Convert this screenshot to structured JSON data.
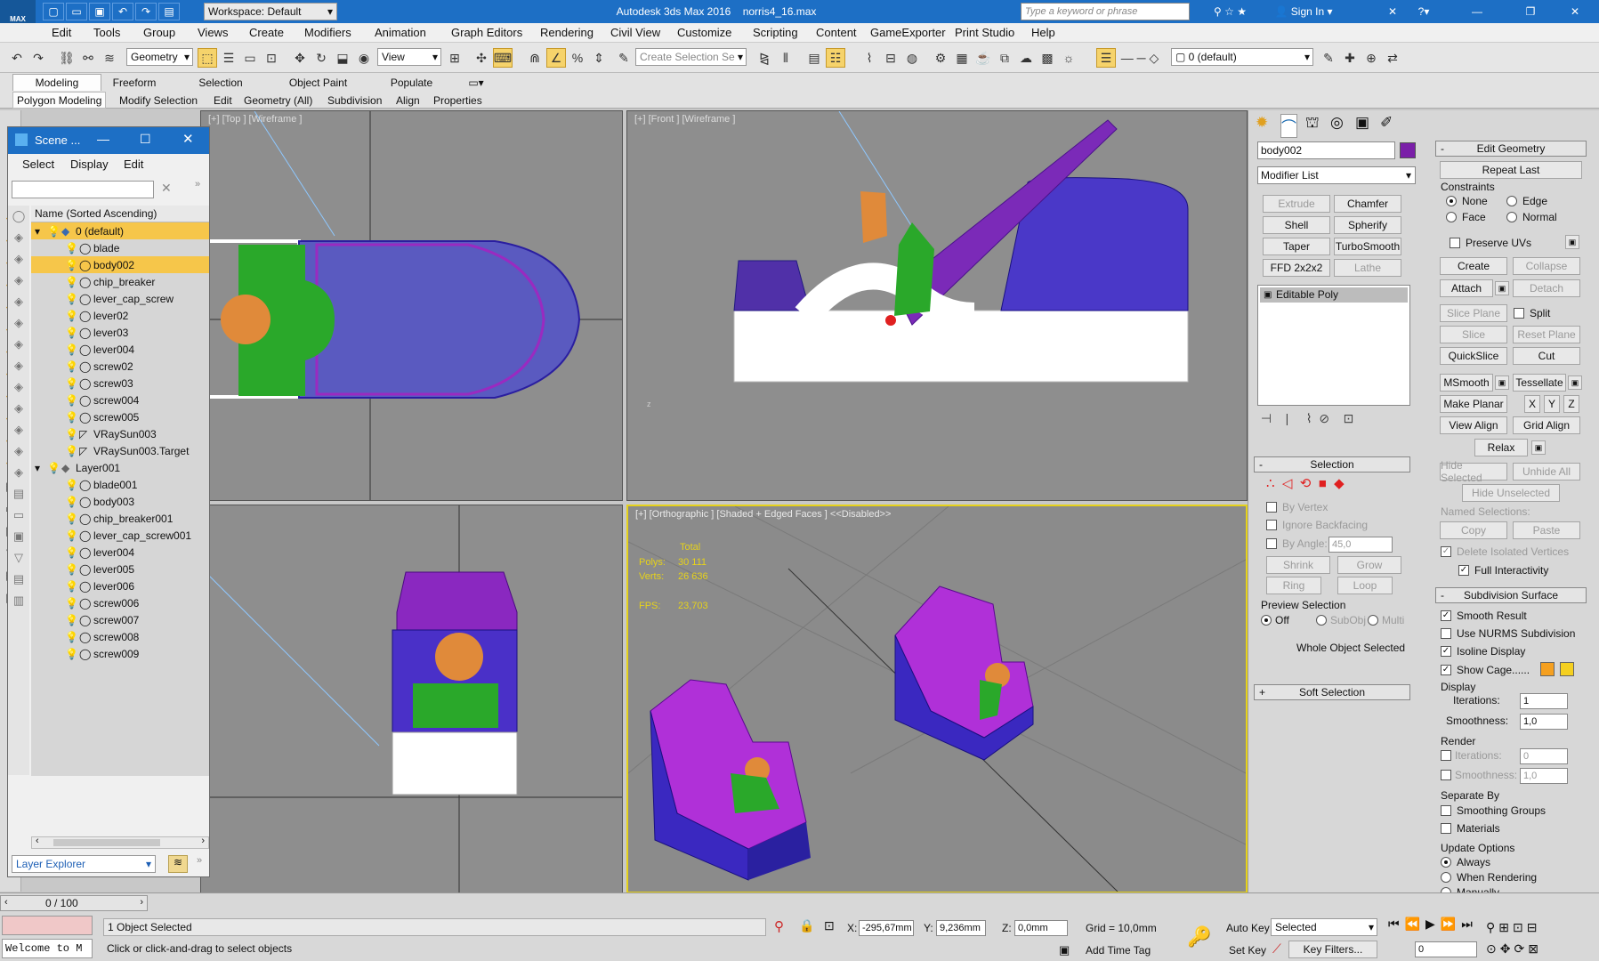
{
  "titlebar": {
    "app_title": "Autodesk 3ds Max 2016",
    "file_name": "norris4_16.max",
    "workspace": "Workspace: Default",
    "search_placeholder": "Type a keyword or phrase",
    "sign_in": "Sign In",
    "logo": "MAX"
  },
  "menu": [
    "Edit",
    "Tools",
    "Group",
    "Views",
    "Create",
    "Modifiers",
    "Animation",
    "Graph Editors",
    "Rendering",
    "Civil View",
    "Customize",
    "Scripting",
    "Content",
    "GameExporter",
    "Print Studio",
    "Help"
  ],
  "toolbar": {
    "selection_filter": "Geometry",
    "ref_coord": "View",
    "named_selection_placeholder": "Create Selection Se",
    "layer": "0 (default)"
  },
  "ribbon": {
    "tabs": [
      "Modeling",
      "Freeform",
      "Selection",
      "Object Paint",
      "Populate"
    ],
    "subtabs": [
      "Polygon Modeling",
      "Modify Selection",
      "Edit",
      "Geometry (All)",
      "Subdivision",
      "Align",
      "Properties"
    ]
  },
  "viewports": {
    "top": "[+] [Top ] [Wireframe ]",
    "front": "[+] [Front ] [Wireframe ]",
    "left": "",
    "persp": "[+] [Orthographic ] [Shaded + Edged Faces ]  <<Disabled>>",
    "stats": {
      "total_label": "Total",
      "polys_label": "Polys:",
      "polys": "30 111",
      "verts_label": "Verts:",
      "verts": "26 636",
      "fps_label": "FPS:",
      "fps": "23,703"
    }
  },
  "scene": {
    "title": "Scene ...",
    "menu": [
      "Select",
      "Display",
      "Edit"
    ],
    "column": "Name (Sorted Ascending)",
    "footer": "Layer Explorer",
    "layer1": "0 (default)",
    "items1": [
      "blade",
      "body002",
      "chip_breaker",
      "lever_cap_screw",
      "lever02",
      "lever03",
      "lever004",
      "screw02",
      "screw03",
      "screw004",
      "screw005",
      "VRaySun003",
      "VRaySun003.Target"
    ],
    "layer2": "Layer001",
    "items2": [
      "blade001",
      "body003",
      "chip_breaker001",
      "lever_cap_screw001",
      "lever004",
      "lever005",
      "lever006",
      "screw006",
      "screw007",
      "screw008",
      "screw009"
    ]
  },
  "cmd": {
    "object_name": "body002",
    "object_color": "#7a1fa8",
    "modifier_list": "Modifier List",
    "mod_buttons": [
      "Extrude",
      "Chamfer",
      "Shell",
      "Spherify",
      "Taper",
      "TurboSmooth",
      "FFD 2x2x2",
      "Lathe"
    ],
    "stack_item": "Editable Poly",
    "selection": {
      "title": "Selection",
      "by_vertex": "By Vertex",
      "ignore_backfacing": "Ignore Backfacing",
      "by_angle": "By Angle:",
      "angle": "45,0",
      "shrink": "Shrink",
      "grow": "Grow",
      "ring": "Ring",
      "loop": "Loop",
      "preview": "Preview Selection",
      "off": "Off",
      "subobj": "SubObj",
      "multi": "Multi",
      "whole": "Whole Object Selected"
    },
    "soft_selection": "Soft Selection",
    "edit_geometry": {
      "title": "Edit Geometry",
      "repeat_last": "Repeat Last",
      "constraints": "Constraints",
      "none": "None",
      "edge": "Edge",
      "face": "Face",
      "normal": "Normal",
      "preserve_uvs": "Preserve UVs",
      "create": "Create",
      "collapse": "Collapse",
      "attach": "Attach",
      "detach": "Detach",
      "slice_plane": "Slice Plane",
      "split": "Split",
      "slice": "Slice",
      "reset_plane": "Reset Plane",
      "quickslice": "QuickSlice",
      "cut": "Cut",
      "msmooth": "MSmooth",
      "tessellate": "Tessellate",
      "make_planar": "Make Planar",
      "x": "X",
      "y": "Y",
      "z": "Z",
      "view_align": "View Align",
      "grid_align": "Grid Align",
      "relax": "Relax",
      "hide_selected": "Hide Selected",
      "unhide_all": "Unhide All",
      "hide_unselected": "Hide Unselected",
      "named_selections": "Named Selections:",
      "copy": "Copy",
      "paste": "Paste",
      "delete_isolated": "Delete Isolated Vertices",
      "full_interactivity": "Full Interactivity"
    },
    "subdivision": {
      "title": "Subdivision Surface",
      "smooth_result": "Smooth Result",
      "use_nurms": "Use NURMS Subdivision",
      "isoline": "Isoline Display",
      "show_cage": "Show Cage......",
      "display": "Display",
      "iterations": "Iterations:",
      "iter_val": "1",
      "smoothness": "Smoothness:",
      "smooth_val": "1,0",
      "render": "Render",
      "r_iter_val": "0",
      "r_smooth_val": "1,0",
      "separate_by": "Separate By",
      "smoothing_groups": "Smoothing Groups",
      "materials": "Materials",
      "update_options": "Update Options",
      "always": "Always",
      "when_rendering": "When Rendering",
      "manually": "Manually"
    }
  },
  "status": {
    "frame": "0 / 100",
    "welcome": "Welcome to M",
    "selected": "1 Object Selected",
    "prompt": "Click or click-and-drag to select objects",
    "x_label": "X:",
    "x": "-295,67mm",
    "y_label": "Y:",
    "y": "9,236mm",
    "z_label": "Z:",
    "z": "0,0mm",
    "grid": "Grid = 10,0mm",
    "auto_key": "Auto Key",
    "set_key": "Set Key",
    "key_mode": "Selected",
    "key_filters": "Key Filters...",
    "add_time_tag": "Add Time Tag",
    "frame_num": "0"
  }
}
